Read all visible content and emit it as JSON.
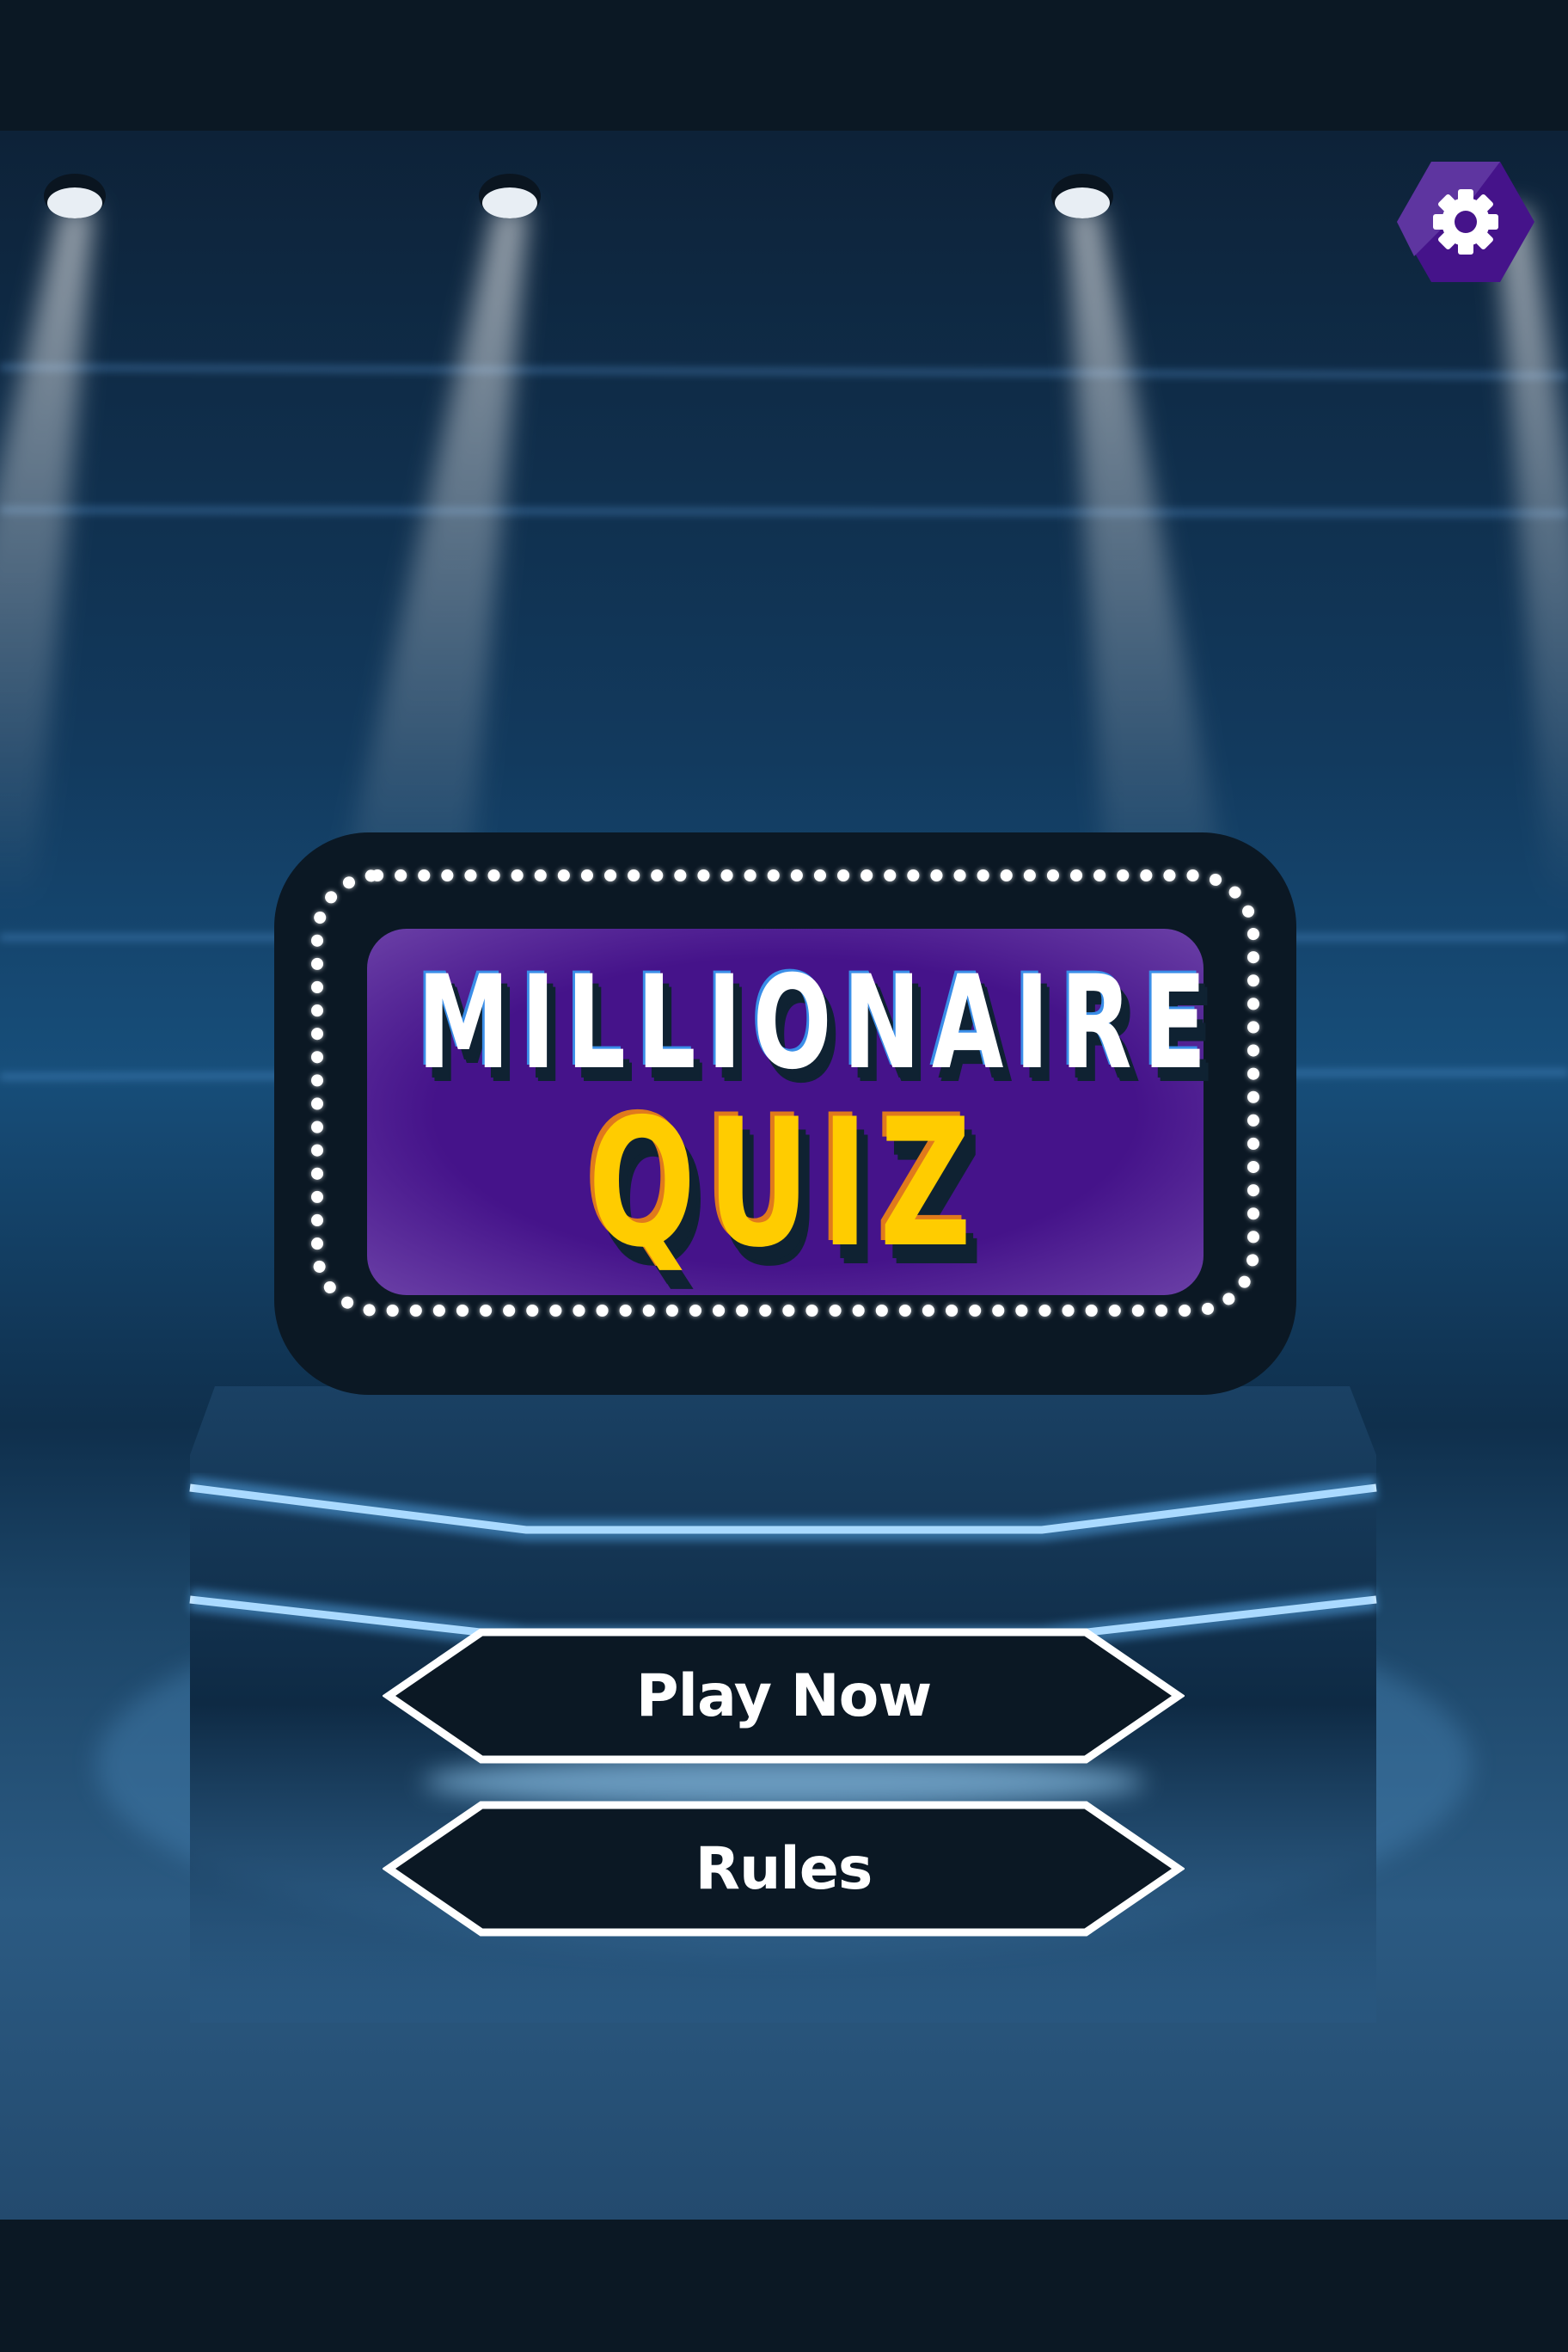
{
  "game": {
    "title_line1": "MILLIONAIRE",
    "title_line2": "QUIZ"
  },
  "header": {
    "settings_icon": "gear-icon"
  },
  "menu": {
    "play_label": "Play Now",
    "rules_label": "Rules"
  },
  "colors": {
    "accent_purple": "#4a148c",
    "title_yellow": "#ffcc00",
    "button_bg": "#0b1824",
    "button_border": "#ffffff"
  }
}
